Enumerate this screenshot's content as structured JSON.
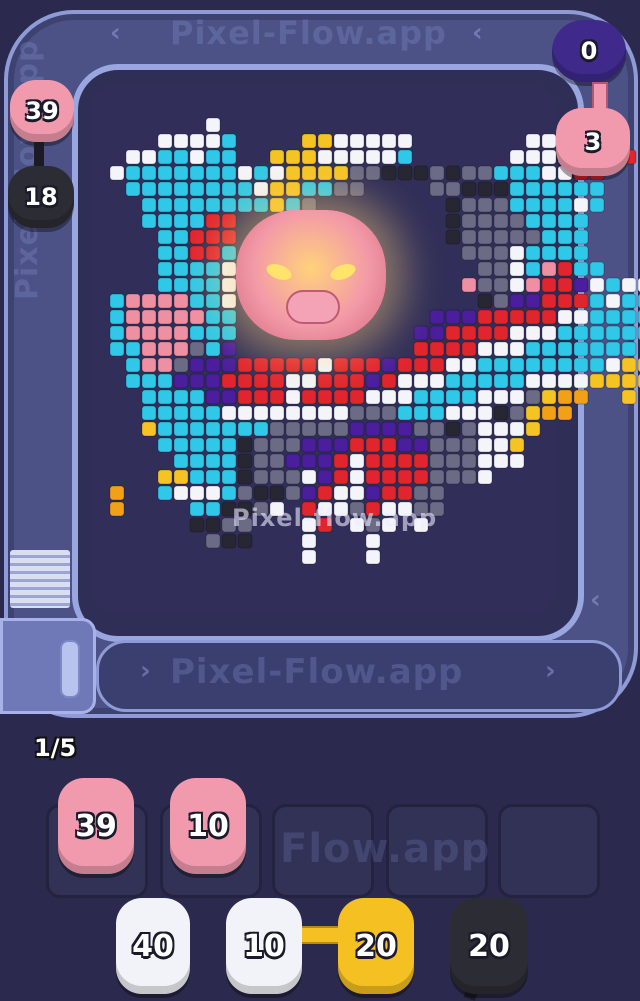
{
  "watermark": {
    "text_top": "Pixel-Flow.app",
    "text_mid": "Pixel-flow.app",
    "text_lane": "Pixel-Flow.app",
    "text_side": "Pixel-Flow.app",
    "text_slots": "Flow.app"
  },
  "progress": {
    "label": "1/5"
  },
  "track_pigs": [
    {
      "id": "pig-pink-topleft",
      "value": "39",
      "color": "#f19aae"
    },
    {
      "id": "pig-black-left",
      "value": "18",
      "color": "#2c2c34"
    },
    {
      "id": "pig-purple-topright",
      "value": "0",
      "color": "#3f2a8c"
    },
    {
      "id": "pig-pink-right",
      "value": "3",
      "color": "#f19aae"
    }
  ],
  "slots": [
    {
      "value": "39",
      "color": "#f19aae"
    },
    {
      "value": "10",
      "color": "#f19aae"
    },
    {
      "value": "",
      "color": ""
    },
    {
      "value": "",
      "color": ""
    },
    {
      "value": "",
      "color": ""
    }
  ],
  "queue": [
    {
      "value": "40",
      "color": "#f2f3f8"
    },
    {
      "value": "10",
      "color": "#f2f3f8"
    },
    {
      "value": "20",
      "color": "#f5c021"
    },
    {
      "value": "20",
      "color": "#2c2c34"
    }
  ],
  "palette": {
    "c": "#2fc8e8",
    "w": "#f4f5fa",
    "r": "#e0252f",
    "p": "#4a1e9c",
    "k": "#272733",
    "g": "#6c6b86",
    "y": "#f5c424",
    "n": "#ef8fa4",
    "o": "#f2a018"
  },
  "boss": {
    "name": "pig-boss",
    "color": "#ee98a8"
  }
}
